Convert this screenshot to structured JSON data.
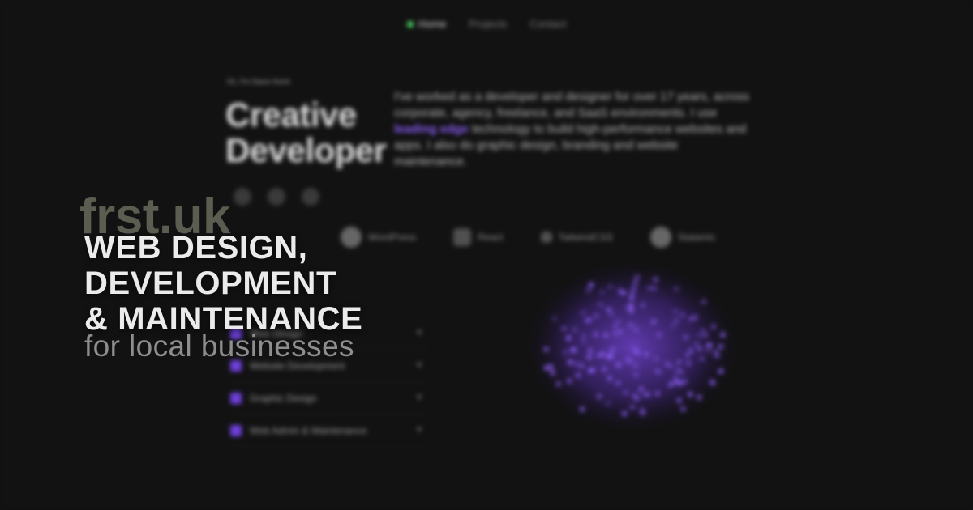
{
  "nav": {
    "items": [
      {
        "label": "Home"
      },
      {
        "label": "Projects"
      },
      {
        "label": "Contact"
      }
    ],
    "active_color": "#4cd964"
  },
  "background": {
    "intro": "Hi, I'm Dave Kent",
    "title_line1": "Creative",
    "title_line2": "Developer",
    "text_before": "I've worked as a developer and designer for over 17 years, across corporate, agency, freelance, and SaaS environments. I use ",
    "text_highlight": "leading edge",
    "text_after": " technology to build high-performance websites and apps. I also do graphic design, branding and website maintenance.",
    "highlight_color": "#8b5cf6",
    "tools": [
      {
        "label": "WordPress",
        "icon": "wordpress-icon"
      },
      {
        "label": "React",
        "icon": "react-icon"
      },
      {
        "label": "TailwindCSS",
        "icon": "tailwind-icon"
      },
      {
        "label": "Statamic",
        "icon": "statamic-icon"
      }
    ],
    "services": [
      {
        "label": "Web Design"
      },
      {
        "label": "Website Development"
      },
      {
        "label": "Graphic Design"
      },
      {
        "label": "Web Admin & Maintenance"
      }
    ],
    "accent_color": "#6d3fd8"
  },
  "overlay": {
    "brand": "frst.uk",
    "headline_line1": "WEB DESIGN,",
    "headline_line2": "DEVELOPMENT",
    "headline_line3": "& MAINTENANCE",
    "tagline": "for local businesses"
  }
}
